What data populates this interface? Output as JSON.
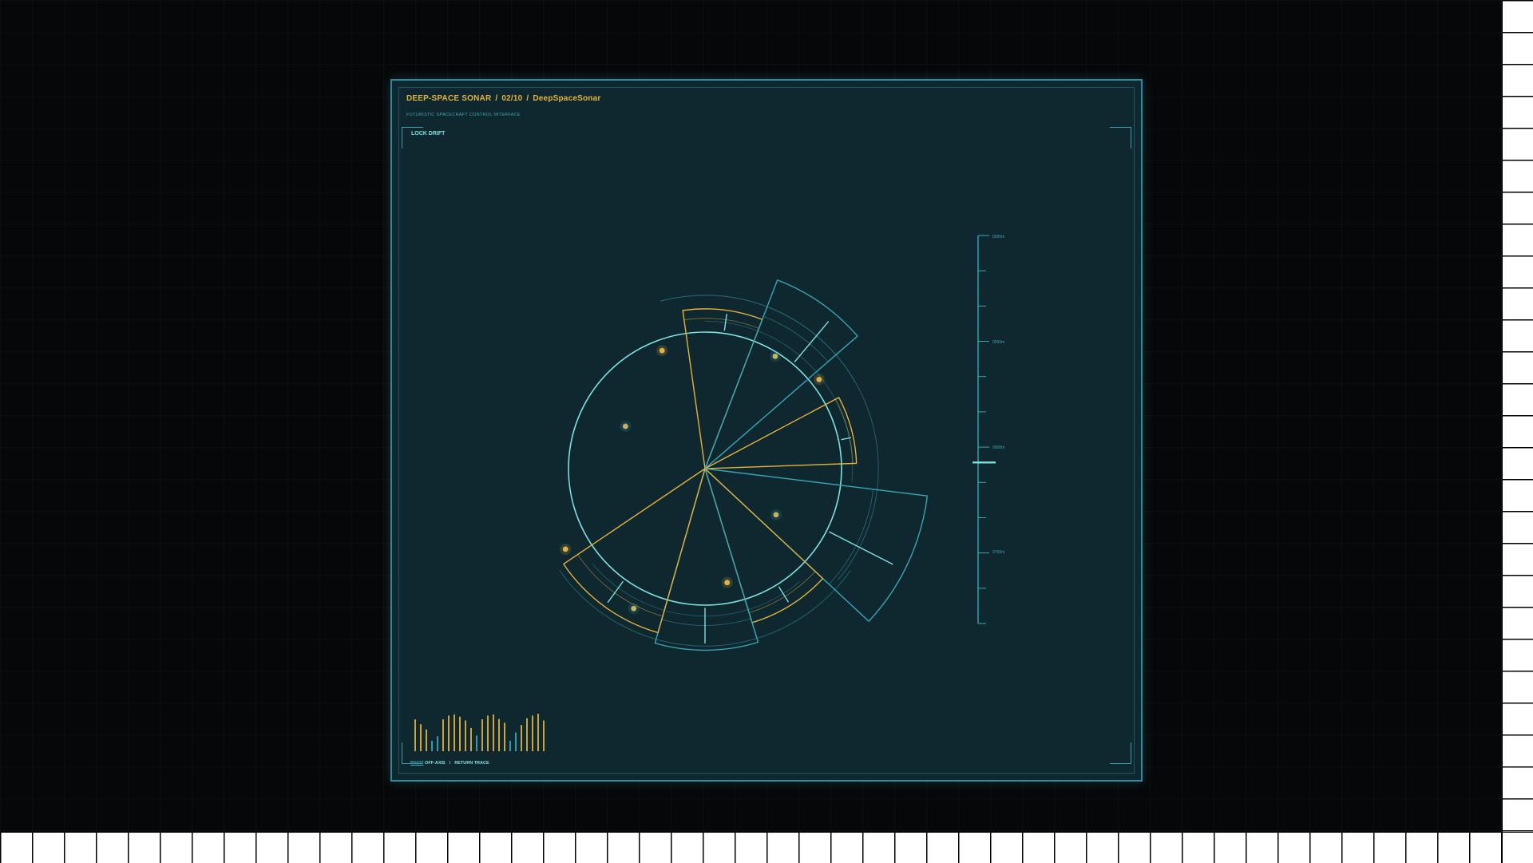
{
  "header": {
    "app_name": "DEEP-SPACE SONAR",
    "sep1": "/",
    "page_counter": "02/10",
    "sep2": "/",
    "project": "DeepSpaceSonar",
    "subtitle": "FUTURISTIC SPACECRAFT CONTROL INTERFACE"
  },
  "controls": {
    "lock_drift": "LOCK DRIFT",
    "pivot": "PIVOT",
    "off_axis": "OFF-AXIS",
    "slash": "/",
    "return_trace": "RETURN TRACE"
  },
  "depth_scale": {
    "labels": [
      "0000m",
      "0250m",
      "0500m",
      "0750m"
    ],
    "marker_fraction": 0.585
  },
  "colors": {
    "panel_bg": "#0f2830",
    "frame": "#2e8a9c",
    "cyan": "#7fe0e2",
    "teal": "#3aa6b8",
    "amber": "#e3b23c"
  },
  "sonar": {
    "sectors": [
      {
        "start": -8,
        "end": 21,
        "outer": 1.17,
        "ticks": [
          8
        ],
        "color": "amber"
      },
      {
        "start": 21,
        "end": 49,
        "outer": 1.48,
        "ticks": [
          40
        ],
        "color": "teal"
      },
      {
        "start": 62,
        "end": 88,
        "outer": 1.11,
        "ticks": [
          78
        ],
        "color": "amber"
      },
      {
        "start": 97,
        "end": 133,
        "outer": 1.64,
        "ticks": [
          117
        ],
        "color": "teal"
      },
      {
        "start": 133,
        "end": 163,
        "outer": 1.18,
        "ticks": [
          148
        ],
        "color": "amber"
      },
      {
        "start": 163,
        "end": 196,
        "outer": 1.33,
        "ticks": [
          180
        ],
        "color": "teal"
      },
      {
        "start": 196,
        "end": 236,
        "outer": 1.25,
        "ticks": [
          216
        ],
        "color": "amber"
      }
    ],
    "contacts": [
      {
        "angle": -20,
        "dist": 0.92,
        "color": "amber"
      },
      {
        "angle": 52,
        "dist": 1.06,
        "color": "amber"
      },
      {
        "angle": 32,
        "dist": 0.97,
        "color": "teal"
      },
      {
        "angle": -62,
        "dist": 0.66,
        "color": "teal"
      },
      {
        "angle": 123,
        "dist": 0.62,
        "color": "teal"
      },
      {
        "angle": 169,
        "dist": 0.85,
        "color": "amber"
      },
      {
        "angle": 207,
        "dist": 1.15,
        "color": "teal"
      },
      {
        "angle": 240,
        "dist": 1.18,
        "color": "amber"
      }
    ]
  },
  "signal_bars": [
    {
      "h": 0.85,
      "c": "amber"
    },
    {
      "h": 0.72,
      "c": "amber"
    },
    {
      "h": 0.58,
      "c": "amber"
    },
    {
      "h": 0.28,
      "c": "teal"
    },
    {
      "h": 0.4,
      "c": "teal"
    },
    {
      "h": 0.85,
      "c": "amber"
    },
    {
      "h": 0.95,
      "c": "amber"
    },
    {
      "h": 0.98,
      "c": "amber"
    },
    {
      "h": 0.92,
      "c": "amber"
    },
    {
      "h": 0.82,
      "c": "amber"
    },
    {
      "h": 0.62,
      "c": "amber"
    },
    {
      "h": 0.42,
      "c": "teal"
    },
    {
      "h": 0.85,
      "c": "amber"
    },
    {
      "h": 0.95,
      "c": "amber"
    },
    {
      "h": 0.98,
      "c": "amber"
    },
    {
      "h": 0.86,
      "c": "amber"
    },
    {
      "h": 0.76,
      "c": "amber"
    },
    {
      "h": 0.28,
      "c": "teal"
    },
    {
      "h": 0.5,
      "c": "teal"
    },
    {
      "h": 0.7,
      "c": "amber"
    },
    {
      "h": 0.88,
      "c": "amber"
    },
    {
      "h": 0.95,
      "c": "amber"
    },
    {
      "h": 1.0,
      "c": "amber"
    },
    {
      "h": 0.82,
      "c": "amber"
    }
  ]
}
